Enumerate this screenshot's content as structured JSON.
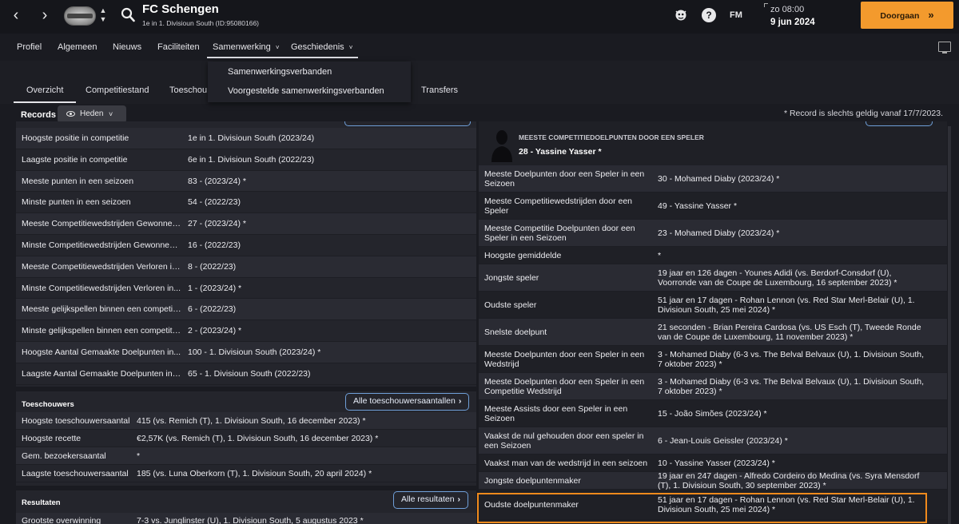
{
  "header": {
    "club_name": "FC Schengen",
    "club_sub": "1e in 1. Divisioun South (ID:95080166)",
    "date_time": "zo 08:00",
    "date_day": "9 jun 2024",
    "continue_label": "Doorgaan",
    "fm_label": "FM",
    "help_label": "?",
    "back_icon": "chevron-left-icon",
    "forward_icon": "chevron-right-icon"
  },
  "nav": {
    "items": [
      "Profiel",
      "Algemeen",
      "Nieuws",
      "Faciliteiten",
      "Samenwerking",
      "Geschiedenis"
    ],
    "active": "Samenwerking"
  },
  "subtabs": {
    "items": [
      "Overzicht",
      "Competitiestand",
      "Toeschou",
      "Transfers"
    ],
    "active": "Overzicht"
  },
  "dropdown": {
    "items": [
      "Samenwerkingsverbanden",
      "Voorgestelde samenwerkingsverbanden"
    ]
  },
  "records": {
    "label": "Records",
    "filter_label": "Heden",
    "note": "* Record is slechts geldig vanaf 17/7/2023."
  },
  "competition_records": [
    {
      "k": "Hoogste positie in competitie",
      "v": "1e in 1. Divisioun South (2023/24)"
    },
    {
      "k": "Laagste positie in competitie",
      "v": "6e in 1. Divisioun South (2022/23)"
    },
    {
      "k": "Meeste punten in een seizoen",
      "v": "83 - (2023/24) *"
    },
    {
      "k": "Minste punten in een seizoen",
      "v": "54 - (2022/23)"
    },
    {
      "k": "Meeste Competitiewedstrijden Gewonnen...",
      "v": "27 - (2023/24) *"
    },
    {
      "k": "Minste Competitiewedstrijden Gewonnen i...",
      "v": "16 - (2022/23)"
    },
    {
      "k": "Meeste Competitiewedstrijden Verloren in...",
      "v": "8 - (2022/23)"
    },
    {
      "k": "Minste Competitiewedstrijden Verloren in...",
      "v": "1 - (2023/24) *"
    },
    {
      "k": "Meeste gelijkspellen binnen een competiti...",
      "v": "6 - (2022/23)"
    },
    {
      "k": "Minste gelijkspellen binnen een competitie...",
      "v": "2 - (2023/24) *"
    },
    {
      "k": "Hoogste Aantal Gemaakte Doelpunten in...",
      "v": "100 - 1. Divisioun South (2023/24) *"
    },
    {
      "k": "Laagste Aantal Gemaakte Doelpunten in e...",
      "v": "65 - 1. Divisioun South (2022/23)"
    }
  ],
  "attendance": {
    "title": "Toeschouwers",
    "button": "Alle toeschouwersaantallen",
    "rows": [
      {
        "k": "Hoogste toeschouwersaantal",
        "v": "415 (vs. Remich (T), 1. Divisioun South, 16 december 2023) *"
      },
      {
        "k": "Hoogste recette",
        "v": "€2,57K (vs. Remich (T), 1. Divisioun South, 16 december 2023) *"
      },
      {
        "k": "Gem. bezoekersaantal",
        "v": "*"
      },
      {
        "k": "Laagste toeschouwersaantal",
        "v": "185 (vs. Luna Oberkorn (T), 1. Divisioun South, 20 april 2024) *"
      }
    ]
  },
  "results": {
    "title": "Resultaten",
    "button": "Alle resultaten",
    "rows": [
      {
        "k": "Grootste overwinning",
        "v": "7-3 vs. Junglinster (U), 1. Divisioun South, 5 augustus 2023 *"
      }
    ]
  },
  "player_records": {
    "featured_title": "MEESTE COMPETITIEDOELPUNTEN DOOR EEN SPELER",
    "featured_value": "28 - Yassine Yasser *",
    "rows": [
      {
        "k": "Meeste Doelpunten door een Speler in een Seizoen",
        "v": "30 - Mohamed Diaby (2023/24) *"
      },
      {
        "k": "Meeste Competitiewedstrijden door een Speler",
        "v": "49 - Yassine Yasser *"
      },
      {
        "k": "Meeste Competitie Doelpunten door een Speler in een Seizoen",
        "v": "23 - Mohamed Diaby (2023/24) *"
      },
      {
        "k": "Hoogste gemiddelde",
        "v": "*"
      },
      {
        "k": "Jongste speler",
        "v": "19 jaar en 126 dagen - Younes Adidi (vs. Berdorf-Consdorf (U), Voorronde van de Coupe de Luxembourg, 16 september 2023) *"
      },
      {
        "k": "Oudste speler",
        "v": "51 jaar en 17 dagen - Rohan Lennon (vs. Red Star Merl-Belair (U), 1. Divisioun South, 25 mei 2024) *"
      },
      {
        "k": "Snelste doelpunt",
        "v": "21 seconden - Brian Pereira Cardosa (vs. US Esch (T), Tweede Ronde van de Coupe de Luxembourg, 11 november 2023) *"
      },
      {
        "k": "Meeste Doelpunten door een Speler in een Wedstrijd",
        "v": "3 - Mohamed Diaby (6-3 vs. The Belval Belvaux (U), 1. Divisioun South, 7 oktober 2023) *"
      },
      {
        "k": "Meeste Doelpunten door een Speler in een Competitie Wedstrijd",
        "v": "3 - Mohamed Diaby (6-3 vs. The Belval Belvaux (U), 1. Divisioun South, 7 oktober 2023) *"
      },
      {
        "k": "Meeste Assists door een Speler in een Seizoen",
        "v": "15 - João Simões (2023/24) *"
      },
      {
        "k": "Vaakst de nul gehouden door een speler in een Seizoen",
        "v": "6 - Jean-Louis Geissler (2023/24) *"
      },
      {
        "k": "Vaakst man van de wedstrijd in een seizoen",
        "v": "10 - Yassine Yasser (2023/24) *"
      },
      {
        "k": "Jongste doelpuntenmaker",
        "v": "19 jaar en 247 dagen - Alfredo Cordeiro do Medina (vs. Syra Mensdorf (T), 1. Divisioun South, 30 september 2023) *"
      },
      {
        "k": "Oudste doelpuntenmaker",
        "v": "51 jaar en 17 dagen - Rohan Lennon (vs. Red Star Merl-Belair (U), 1. Divisioun South, 25 mei 2024) *"
      }
    ]
  },
  "colors": {
    "accent_orange": "#f39a2d",
    "highlight_border": "#f08a1c",
    "link_border": "#6f9fd8",
    "panel_bg": "#24252c"
  }
}
